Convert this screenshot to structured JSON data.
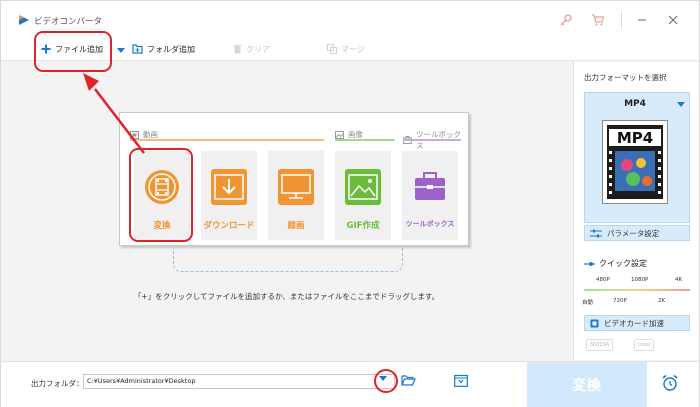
{
  "app": {
    "title": "ビデオコンバータ"
  },
  "toolbar": {
    "add_file": "ファイル追加",
    "add_folder": "フォルダ追加",
    "clear": "クリア",
    "merge": "マージ"
  },
  "categories": {
    "video": "動画",
    "image": "画像",
    "toolbox": "ツールボックス"
  },
  "tiles": [
    {
      "label": "変換",
      "color": "#f09533"
    },
    {
      "label": "ダウンロード",
      "color": "#f09533"
    },
    {
      "label": "録画",
      "color": "#f09533"
    },
    {
      "label": "GIF作成",
      "color": "#6cbb3c"
    },
    {
      "label": "ツールボックス",
      "color": "#9b63c9"
    }
  ],
  "hint": "「+」をクリックしてファイルを追加するか、またはファイルをここまでドラッグします。",
  "right_panel": {
    "title": "出力フォーマットを選択",
    "format": "MP4",
    "format_icon_text": "MP4",
    "param_button": "パラメータ設定",
    "quick_title": "クイック設定",
    "quick_top": [
      "480P",
      "1080P",
      "4K"
    ],
    "quick_bottom": [
      "自動",
      "720P",
      "2K"
    ],
    "gpu_button": "ビデオカード加速",
    "gpu_tags": [
      "NVIDIA",
      "Intel"
    ]
  },
  "bottom": {
    "output_label": "出力フォルダ：",
    "output_path": "C:¥Users¥Administrator¥Desktop",
    "convert": "変換"
  },
  "colors": {
    "accent": "#1b78d0",
    "highlight": "#e0232b",
    "orange": "#f09533"
  }
}
